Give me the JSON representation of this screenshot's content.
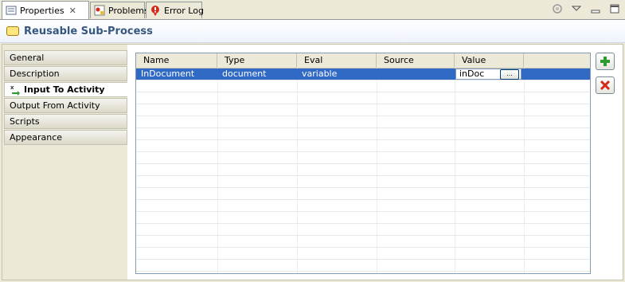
{
  "tabs": [
    {
      "label": "Properties",
      "icon": "properties-icon",
      "active": true
    },
    {
      "label": "Problems",
      "icon": "problems-icon",
      "active": false
    },
    {
      "label": "Error Log",
      "icon": "error-log-icon",
      "active": false
    }
  ],
  "view_tools": [
    "sync-icon",
    "view-menu-icon",
    "minimize-icon",
    "maximize-icon"
  ],
  "header": {
    "title": "Reusable Sub-Process",
    "icon": "subprocess-icon"
  },
  "sidebar": {
    "items": [
      {
        "label": "General",
        "selected": false
      },
      {
        "label": "Description",
        "selected": false
      },
      {
        "label": "Input To Activity",
        "selected": true
      },
      {
        "label": "Output From Activity",
        "selected": false
      },
      {
        "label": "Scripts",
        "selected": false
      },
      {
        "label": "Appearance",
        "selected": false
      }
    ]
  },
  "table": {
    "columns": [
      "Name",
      "Type",
      "Eval",
      "Source",
      "Value"
    ],
    "rows": [
      {
        "name": "InDocument",
        "type": "document",
        "eval": "variable",
        "source": "",
        "value": "inDoc",
        "selected": true
      }
    ],
    "browse_label": "..."
  },
  "buttons": {
    "add": "add-icon",
    "remove": "remove-icon"
  },
  "colors": {
    "selection": "#316ac5",
    "header_title": "#36587f",
    "add_green": "#2f9a2f",
    "remove_red": "#d42a1e"
  }
}
